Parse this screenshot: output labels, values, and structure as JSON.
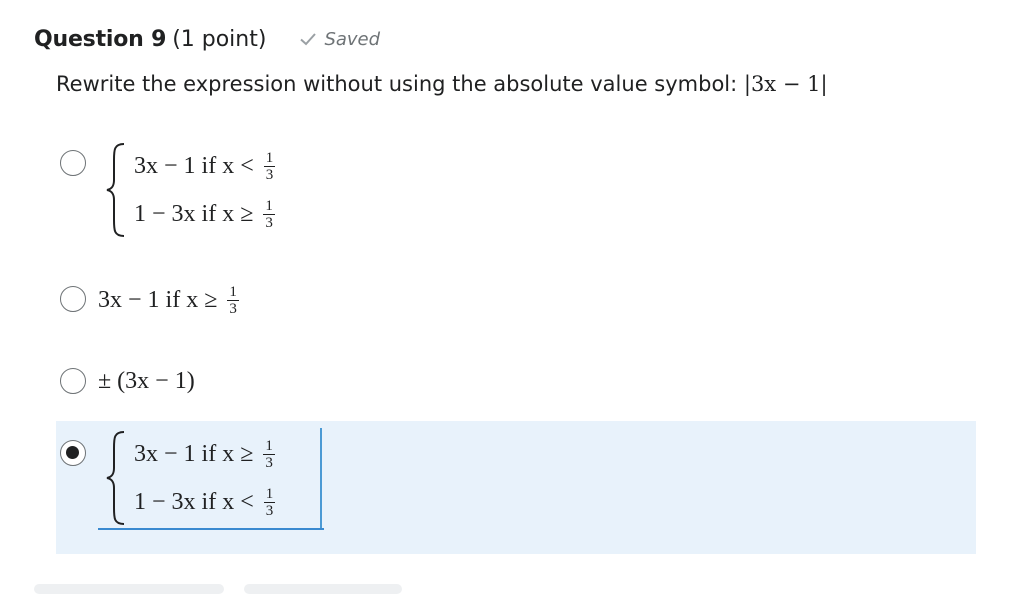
{
  "question": {
    "title": "Question 9",
    "points": "(1 point)",
    "saved_label": "Saved",
    "prompt": "Rewrite the expression without using the absolute value symbol: ",
    "prompt_math": "|3x − 1|"
  },
  "options": [
    {
      "selected": false,
      "type": "piecewise",
      "cases": [
        {
          "expr": "3x − 1 if x <",
          "frac_num": "1",
          "frac_den": "3"
        },
        {
          "expr": "1 − 3x if x ≥",
          "frac_num": "1",
          "frac_den": "3"
        }
      ]
    },
    {
      "selected": false,
      "type": "single",
      "expr": "3x − 1 if x ≥",
      "frac_num": "1",
      "frac_den": "3"
    },
    {
      "selected": false,
      "type": "plain",
      "expr": "± (3x − 1)"
    },
    {
      "selected": true,
      "type": "piecewise",
      "cases": [
        {
          "expr": "3x − 1 if x ≥",
          "frac_num": "1",
          "frac_den": "3"
        },
        {
          "expr": "1 − 3x if x <",
          "frac_num": "1",
          "frac_den": "3"
        }
      ]
    }
  ],
  "colors": {
    "selected_background": "#e8f2fb",
    "selected_border": "#3a8ad0",
    "text": "#202122",
    "muted": "#6e7376"
  },
  "icons": {
    "saved": "check-icon"
  }
}
